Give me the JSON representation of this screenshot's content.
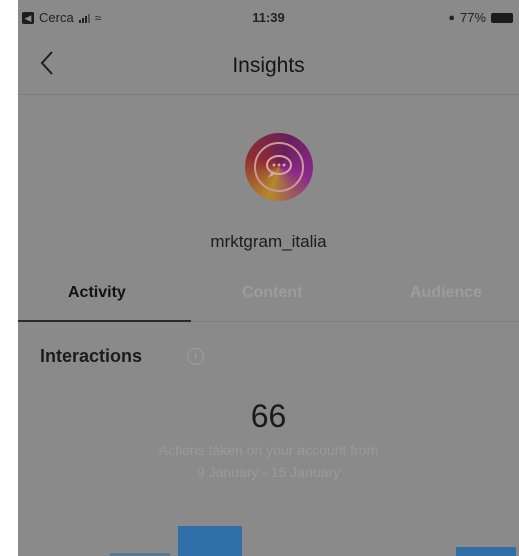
{
  "status_bar": {
    "back_app": "Cerca",
    "time": "11:39",
    "battery": "77%"
  },
  "nav": {
    "title": "Insights"
  },
  "profile": {
    "username": "mrktgram_italia"
  },
  "tabs": [
    {
      "label": "Activity",
      "active": true
    },
    {
      "label": "Content",
      "active": false
    },
    {
      "label": "Audience",
      "active": false
    }
  ],
  "interactions": {
    "title": "Interactions",
    "value": "66",
    "caption_line1": "Actions taken on your account from",
    "caption_line2": "9 January - 15 January"
  },
  "colors": {
    "overlay_gray": "#8a8a8a",
    "bar_blue": "#2f6ea6"
  }
}
